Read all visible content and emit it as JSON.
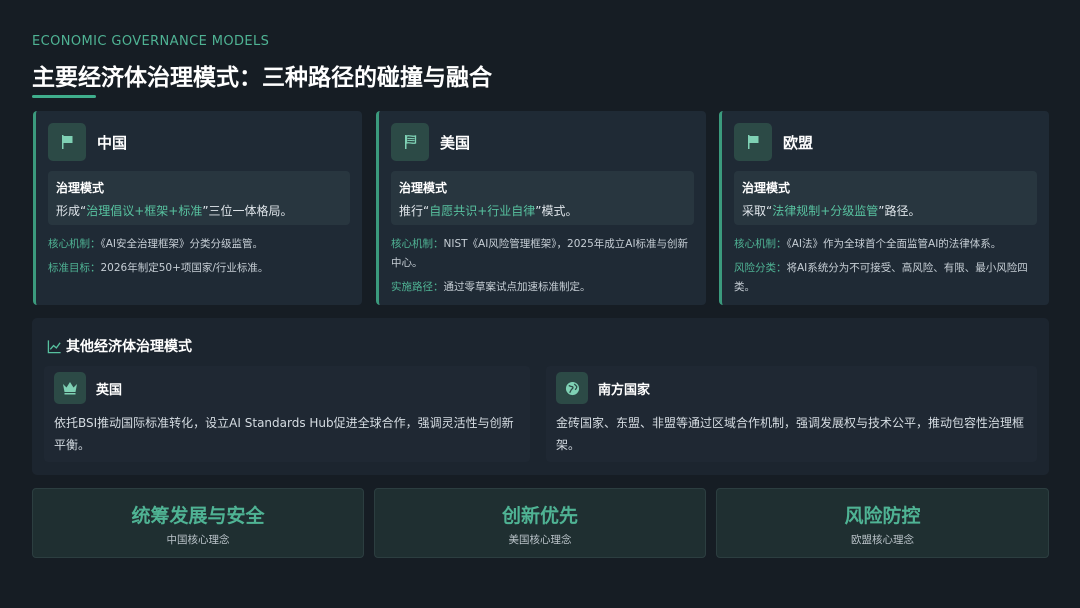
{
  "header": {
    "kicker": "ECONOMIC GOVERNANCE MODELS",
    "title": "主要经济体治理模式：三种路径的碰撞与融合"
  },
  "cards": [
    {
      "name": "中国",
      "icon": "flag-icon",
      "mode_label": "治理模式",
      "mode_prefix": "形成“",
      "mode_highlight": "治理倡议+框架+标准",
      "mode_suffix": "”三位一体格局。",
      "points": [
        {
          "key": "核心机制：",
          "text": "《AI安全治理框架》分类分级监管。"
        },
        {
          "key": "标准目标：",
          "text": "2026年制定50+项国家/行业标准。"
        }
      ]
    },
    {
      "name": "美国",
      "icon": "flag-usa-icon",
      "mode_label": "治理模式",
      "mode_prefix": "推行“",
      "mode_highlight": "自愿共识+行业自律",
      "mode_suffix": "”模式。",
      "points": [
        {
          "key": "核心机制：",
          "text": "NIST《AI风险管理框架》，2025年成立AI标准与创新中心。"
        },
        {
          "key": "实施路径：",
          "text": "通过零草案试点加速标准制定。"
        }
      ]
    },
    {
      "name": "欧盟",
      "icon": "flag-icon",
      "mode_label": "治理模式",
      "mode_prefix": "采取“",
      "mode_highlight": "法律规制+分级监管",
      "mode_suffix": "”路径。",
      "points": [
        {
          "key": "核心机制：",
          "text": "《AI法》作为全球首个全面监管AI的法律体系。"
        },
        {
          "key": "风险分类：",
          "text": "将AI系统分为不可接受、高风险、有限、最小风险四类。"
        }
      ]
    }
  ],
  "other": {
    "title": "其他经济体治理模式",
    "icon": "chart-line-icon",
    "items": [
      {
        "name": "英国",
        "icon": "crown-icon",
        "text": "依托BSI推动国际标准转化，设立AI Standards Hub促进全球合作，强调灵活性与创新平衡。"
      },
      {
        "name": "南方国家",
        "icon": "globe-icon",
        "text": "金砖国家、东盟、非盟等通过区域合作机制，强调发展权与技术公平，推动包容性治理框架。"
      }
    ]
  },
  "concepts": [
    {
      "main": "统筹发展与安全",
      "sub": "中国核心理念"
    },
    {
      "main": "创新优先",
      "sub": "美国核心理念"
    },
    {
      "main": "风险防控",
      "sub": "欧盟核心理念"
    }
  ],
  "colors": {
    "accent": "#4fb394",
    "background": "#161d24",
    "card": "#1f2a35",
    "icon_bg": "#2c4a46"
  }
}
